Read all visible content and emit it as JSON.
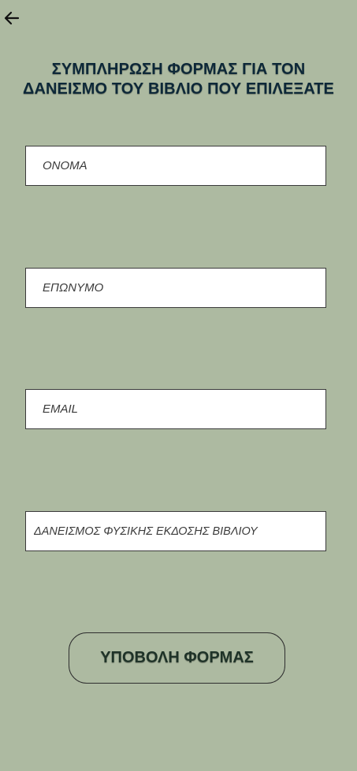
{
  "header": {
    "back_icon": "arrow-left-icon",
    "title_line1": "ΣΥΜΠΛΗΡΩΣΗ ΦΟΡΜΑΣ ΓΙΑ ΤΟΝ",
    "title_line2": "ΔΑΝΕΙΣΜΟ ΤΟΥ ΒΙΒΛΙΟ ΠΟΥ ΕΠΙΛΕΞΑΤΕ"
  },
  "form": {
    "first_name": {
      "placeholder": "ΟΝΟΜΑ",
      "value": ""
    },
    "last_name": {
      "placeholder": "ΕΠΩΝΥΜΟ",
      "value": ""
    },
    "email": {
      "placeholder": "EMAIL",
      "value": ""
    },
    "loan_type": {
      "placeholder": "ΔΑΝΕΙΣΜΟΣ ΦΥΣΙΚΗΣ ΕΚΔΟΣΗΣ ΒΙΒΛΙΟΥ",
      "value": ""
    },
    "submit_label": "ΥΠΟΒΟΛΗ ΦΟΡΜΑΣ"
  },
  "colors": {
    "background": "#adbaa1",
    "title": "#0d2838",
    "field_background": "#ffffff",
    "field_border": "#3a3a3a"
  }
}
